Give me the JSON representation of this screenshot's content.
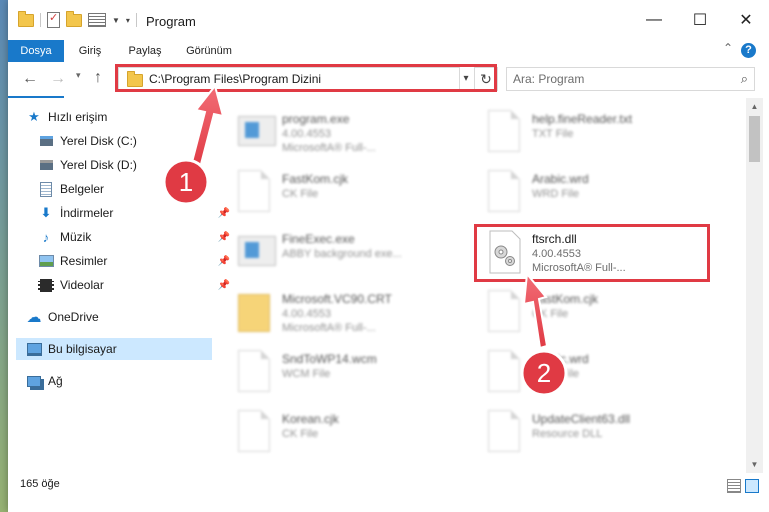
{
  "window": {
    "title": "Program"
  },
  "ribbon": {
    "tabs": [
      {
        "label": "Dosya"
      },
      {
        "label": "Giriş"
      },
      {
        "label": "Paylaş"
      },
      {
        "label": "Görünüm"
      }
    ]
  },
  "addressbar": {
    "path": "C:\\Program Files\\Program Dizini"
  },
  "search": {
    "placeholder": "Ara: Program"
  },
  "sidebar": {
    "items": [
      {
        "label": "Hızlı erişim",
        "icon": "star-icon"
      },
      {
        "label": "Yerel Disk (C:)",
        "icon": "drive-icon"
      },
      {
        "label": "Yerel Disk (D:)",
        "icon": "drive-icon"
      },
      {
        "label": "Belgeler",
        "icon": "documents-icon"
      },
      {
        "label": "İndirmeler",
        "icon": "download-icon"
      },
      {
        "label": "Müzik",
        "icon": "music-icon"
      },
      {
        "label": "Resimler",
        "icon": "pictures-icon"
      },
      {
        "label": "Videolar",
        "icon": "videos-icon"
      },
      {
        "label": "OneDrive",
        "icon": "cloud-icon"
      },
      {
        "label": "Bu bilgisayar",
        "icon": "computer-icon"
      },
      {
        "label": "Ağ",
        "icon": "network-icon"
      }
    ]
  },
  "files": [
    {
      "name": "program.exe",
      "l2": "4.00.4553",
      "l3": "MicrosoftA® Full-..."
    },
    {
      "name": "help.fineReader.txt",
      "l2": "TXT File",
      "l3": ""
    },
    {
      "name": "FastKom.cjk",
      "l2": "CK File",
      "l3": ""
    },
    {
      "name": "Arabic.wrd",
      "l2": "WRD File",
      "l3": ""
    },
    {
      "name": "FineExec.exe",
      "l2": "ABBY background exe...",
      "l3": ""
    },
    {
      "name": "ftsrch.dll",
      "l2": "4.00.4553",
      "l3": "MicrosoftA® Full-..."
    },
    {
      "name": "Microsoft.VC90.CRT",
      "l2": "4.00.4553",
      "l3": "MicrosoftA® Full-..."
    },
    {
      "name": "FastKom.cjk",
      "l2": "CK File",
      "l3": ""
    },
    {
      "name": "SndToWP14.wcm",
      "l2": "WCM File",
      "l3": ""
    },
    {
      "name": "Arabic.wrd",
      "l2": "WRD File",
      "l3": ""
    },
    {
      "name": "Korean.cjk",
      "l2": "CK File",
      "l3": ""
    },
    {
      "name": "UpdateClient63.dll",
      "l2": "Resource DLL",
      "l3": ""
    }
  ],
  "status": {
    "count": "165 öğe"
  },
  "annotations": {
    "badge1": "1",
    "badge2": "2"
  },
  "colors": {
    "accent": "#1979ca",
    "highlight": "#e03a44",
    "selection": "#cce8ff"
  }
}
